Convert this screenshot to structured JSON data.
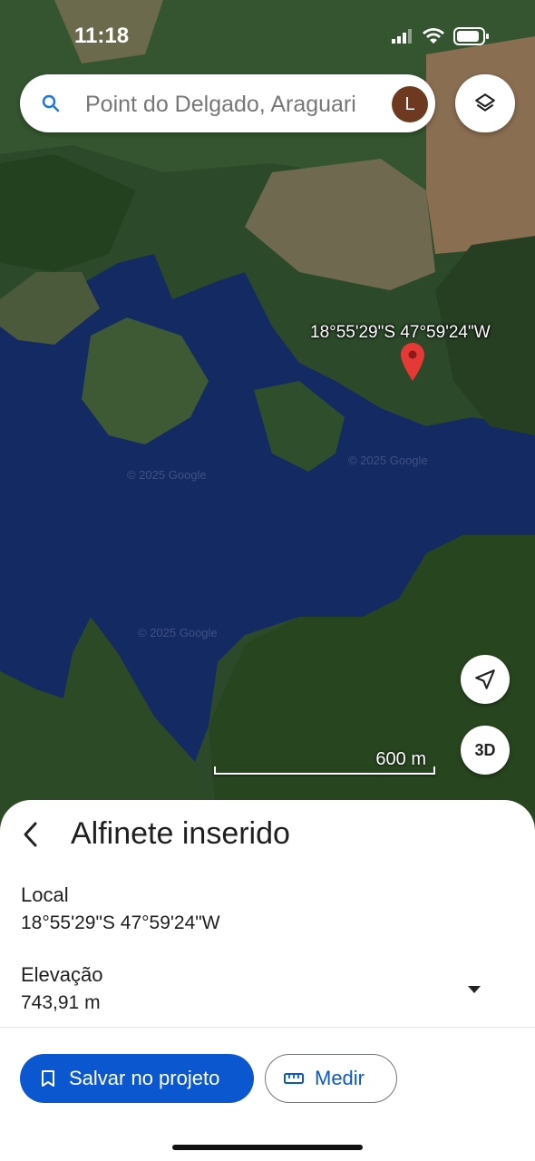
{
  "status_bar": {
    "time": "11:18"
  },
  "search": {
    "text": "Point do Delgado, Araguari"
  },
  "account": {
    "initial": "L"
  },
  "map": {
    "pin_coordinates": "18°55'29\"S 47°59'24\"W",
    "watermark": "© 2025 Google",
    "scale_label": "600 m",
    "btn_3d": "3D"
  },
  "sheet": {
    "title": "Alfinete inserido",
    "location_label": "Local",
    "location_value": "18°55'29\"S 47°59'24\"W",
    "elevation_label": "Elevação",
    "elevation_value": "743,91 m",
    "save_label": "Salvar no projeto",
    "measure_label": "Medir"
  },
  "colors": {
    "water": "#142a63",
    "forest": "#2c4a2a",
    "accent": "#0b57d0",
    "pin": "#e53935"
  },
  "icons": {
    "search": "search-icon",
    "layers": "layers-icon",
    "location": "navigation-arrow-icon",
    "back": "chevron-left-icon",
    "bookmark": "bookmark-icon",
    "ruler": "ruler-icon"
  }
}
